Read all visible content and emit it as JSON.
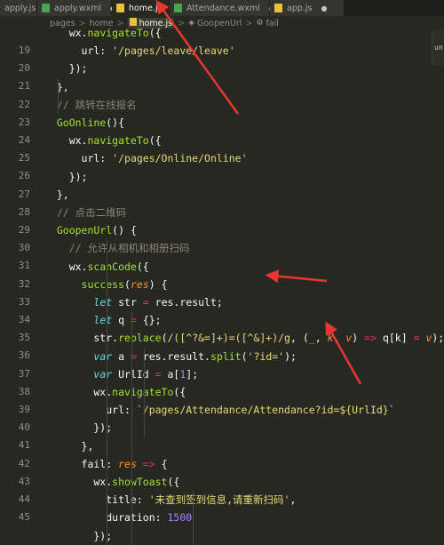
{
  "tabs": [
    {
      "name": "apply.js",
      "icon": "js-file-icon"
    },
    {
      "name": "apply.wxml",
      "icon": "wxml-file-icon"
    },
    {
      "name": "home.js",
      "icon": "js-file-icon",
      "active": true
    },
    {
      "name": "Attendance.wxml",
      "icon": "wxml-file-icon"
    },
    {
      "name": "app.js",
      "icon": "js-file-icon"
    }
  ],
  "breadcrumb": {
    "items": [
      "pages",
      "home",
      "home.js",
      "GoopenUrl",
      "fail"
    ],
    "separator": ">"
  },
  "minimap_label": "un",
  "code": {
    "line_numbers": [
      "19",
      "20",
      "21",
      "22",
      "23",
      "24",
      "25",
      "26",
      "27",
      "28",
      "29",
      "30",
      "31",
      "32",
      "33",
      "34",
      "35",
      "36",
      "37",
      "38",
      "39",
      "40",
      "41",
      "42",
      "43",
      "44",
      "45"
    ],
    "lines": [
      "    wx.navigateTo({",
      "      url: '/pages/leave/leave'",
      "    });",
      "  },",
      "  // 跳转在线报名",
      "  GoOnline(){",
      "    wx.navigateTo({",
      "      url: '/pages/Online/Online'",
      "    });",
      "  },",
      "  // 点击二维码",
      "  GoopenUrl() {",
      "    // 允许从相机和相册扫码",
      "    wx.scanCode({",
      "      success(res) {",
      "        let str = res.result;",
      "        let q = {};",
      "        str.replace(/([^?&=]+)=([^&]+)/g, (_, k, v) => q[k] = v);",
      "        var a = res.result.split('?id=');",
      "        var UrlId = a[1];",
      "        wx.navigateTo({",
      "          url: `/pages/Attendance/Attendance?id=${UrlId}`",
      "        });",
      "      },",
      "      fail: res => {",
      "        wx.showToast({",
      "          title: '未查到签到信息,请重新扫码',",
      "          duration: 1500",
      "        });"
    ]
  }
}
